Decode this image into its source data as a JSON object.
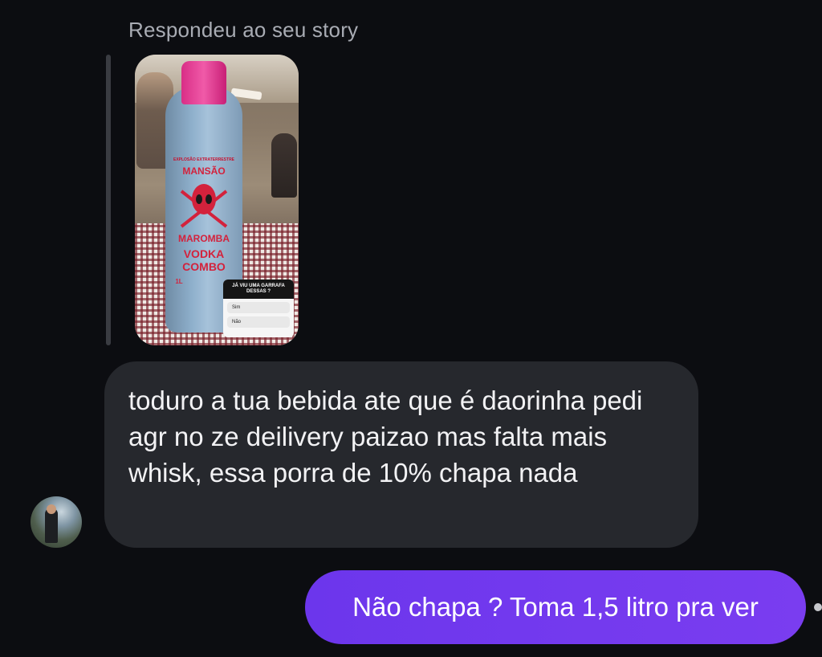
{
  "header": {
    "reply_label": "Respondeu ao seu story"
  },
  "story": {
    "bottle_label_top": "EXPLOSÃO EXTRATERRESTRE",
    "bottle_brand_1": "MANSÃO",
    "bottle_brand_2": "MAROMBA",
    "bottle_product_1": "VODKA",
    "bottle_product_2": "COMBO",
    "bottle_volume": "1L",
    "poll_question": "JÁ VIU UMA GARRAFA DESSAS ?",
    "poll_option_yes": "Sim",
    "poll_option_no": "Não"
  },
  "messages": {
    "incoming_text": "toduro a tua bebida ate que é daorinha pedi agr no ze deilivery paizao mas falta mais whisk, essa porra de 10% chapa nada",
    "outgoing_text": "Não chapa ? Toma 1,5 litro pra ver"
  },
  "colors": {
    "background": "#0c0d11",
    "incoming_bubble": "#26282d",
    "outgoing_bubble": "#7a3df0"
  }
}
